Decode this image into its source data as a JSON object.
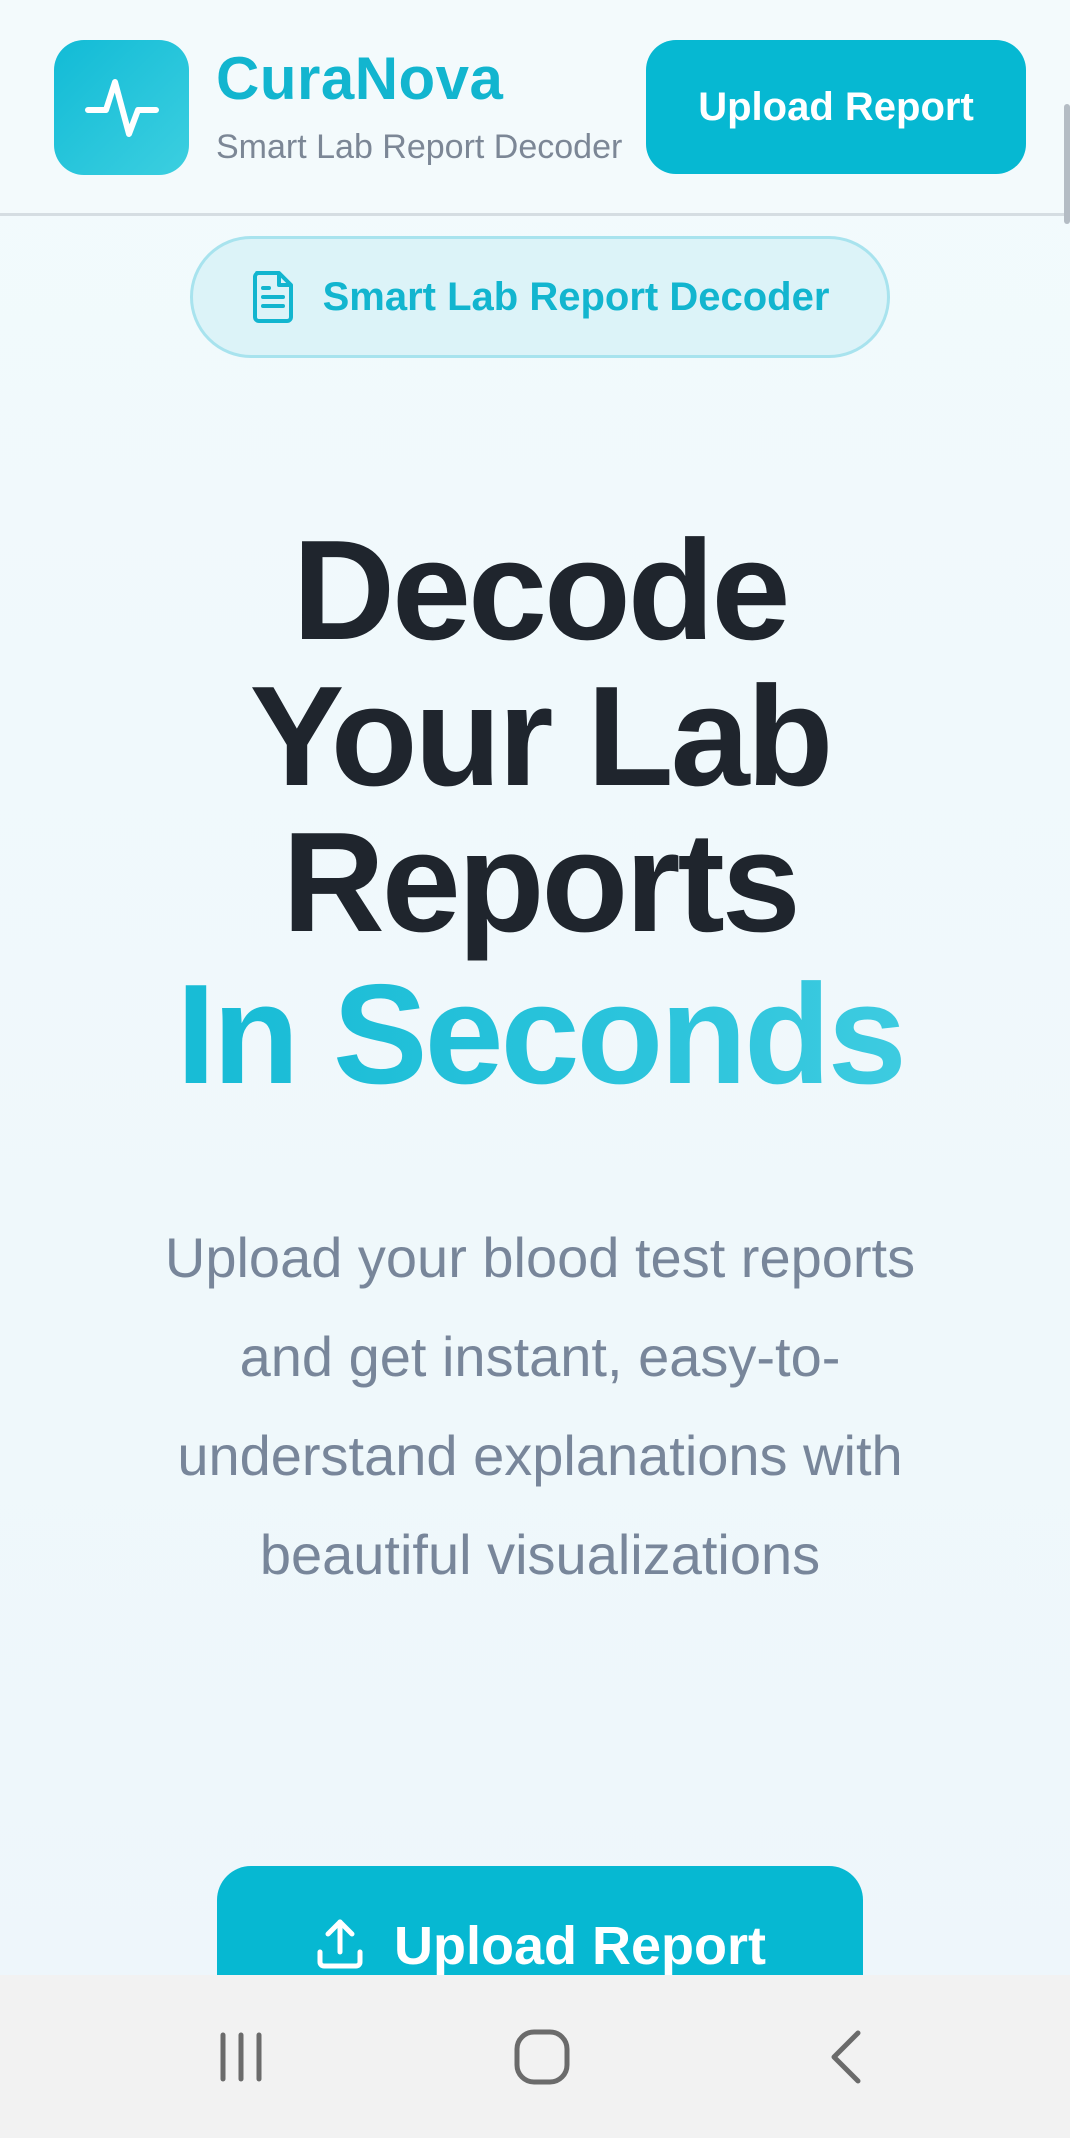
{
  "header": {
    "brand_name": "CuraNova",
    "brand_tagline": "Smart Lab Report Decoder",
    "upload_button": "Upload Report",
    "logo_icon": "activity-pulse-icon"
  },
  "badge": {
    "icon": "document-icon",
    "label": "Smart Lab Report Decoder"
  },
  "hero": {
    "title_lines": [
      "Decode",
      "Your Lab",
      "Reports"
    ],
    "accent": "In Seconds",
    "description": "Upload your blood test reports and get instant, easy-to-understand explanations with beautiful visualizations"
  },
  "cta": {
    "icon": "upload-icon",
    "label": "Upload Report"
  },
  "system_nav": {
    "recents_icon": "recent-apps-icon",
    "home_icon": "home-icon",
    "back_icon": "back-icon"
  },
  "colors": {
    "accent": "#06b8d2",
    "brand_text": "#12b5cf",
    "heading": "#1f252d",
    "body_text": "#78869a"
  }
}
